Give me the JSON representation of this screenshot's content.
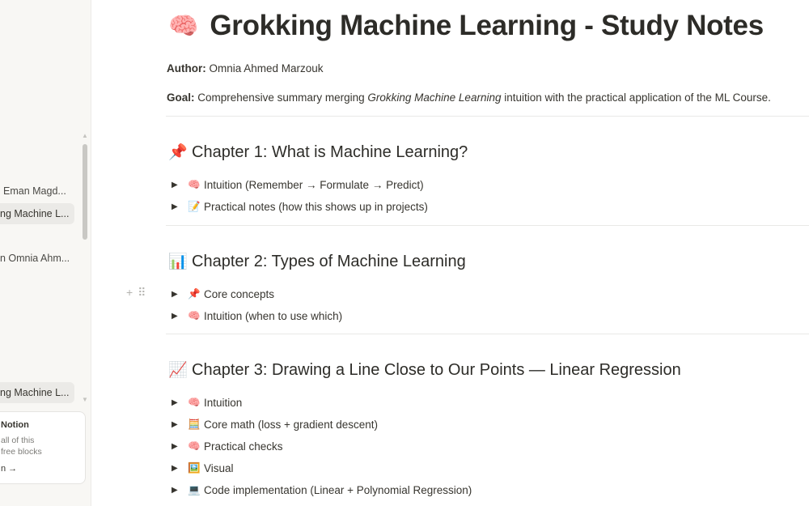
{
  "sidebar": {
    "items": [
      {
        "label": "Eman Magd...",
        "active": false
      },
      {
        "label": "ng Machine L...",
        "active": true
      },
      {
        "label": "n Omnia Ahm...",
        "active": false
      },
      {
        "label": "ng Machine L...",
        "active": true
      }
    ],
    "upgrade": {
      "title": "Notion",
      "line1": "all of this",
      "line2": "free blocks",
      "link": "n →"
    }
  },
  "page": {
    "emoji": "🧠",
    "title": "Grokking Machine Learning - Study Notes",
    "author_label": "Author:",
    "author_value": "Omnia Ahmed Marzouk",
    "goal_label": "Goal:",
    "goal_text_1": "Comprehensive summary merging",
    "goal_italic": "Grokking Machine Learning",
    "goal_text_2": "intuition with the practical application of the ML Course."
  },
  "chapters": [
    {
      "emoji": "📌",
      "title": "Chapter 1: What is Machine Learning?",
      "toggles": [
        {
          "emoji": "🧠",
          "label": "Intuition (Remember → Formulate → Predict)"
        },
        {
          "emoji": "📝",
          "label": "Practical notes (how this shows up in projects)"
        }
      ]
    },
    {
      "emoji": "📊",
      "title": "Chapter 2: Types of Machine Learning",
      "toggles": [
        {
          "emoji": "📌",
          "label": "Core concepts"
        },
        {
          "emoji": "🧠",
          "label": "Intuition (when to use which)"
        }
      ]
    },
    {
      "emoji": "📈",
      "title": "Chapter 3: Drawing a Line Close to Our Points — Linear Regression",
      "toggles": [
        {
          "emoji": "🧠",
          "label": "Intuition"
        },
        {
          "emoji": "🧮",
          "label": "Core math (loss + gradient descent)"
        },
        {
          "emoji": "🧠",
          "label": "Practical checks"
        },
        {
          "emoji": "🖼️",
          "label": "Visual"
        },
        {
          "emoji": "💻",
          "label": "Code implementation (Linear + Polynomial Regression)"
        }
      ]
    }
  ],
  "icons": {
    "toggle": "triangle-right-icon",
    "add": "plus-icon",
    "drag": "drag-handle-icon"
  }
}
